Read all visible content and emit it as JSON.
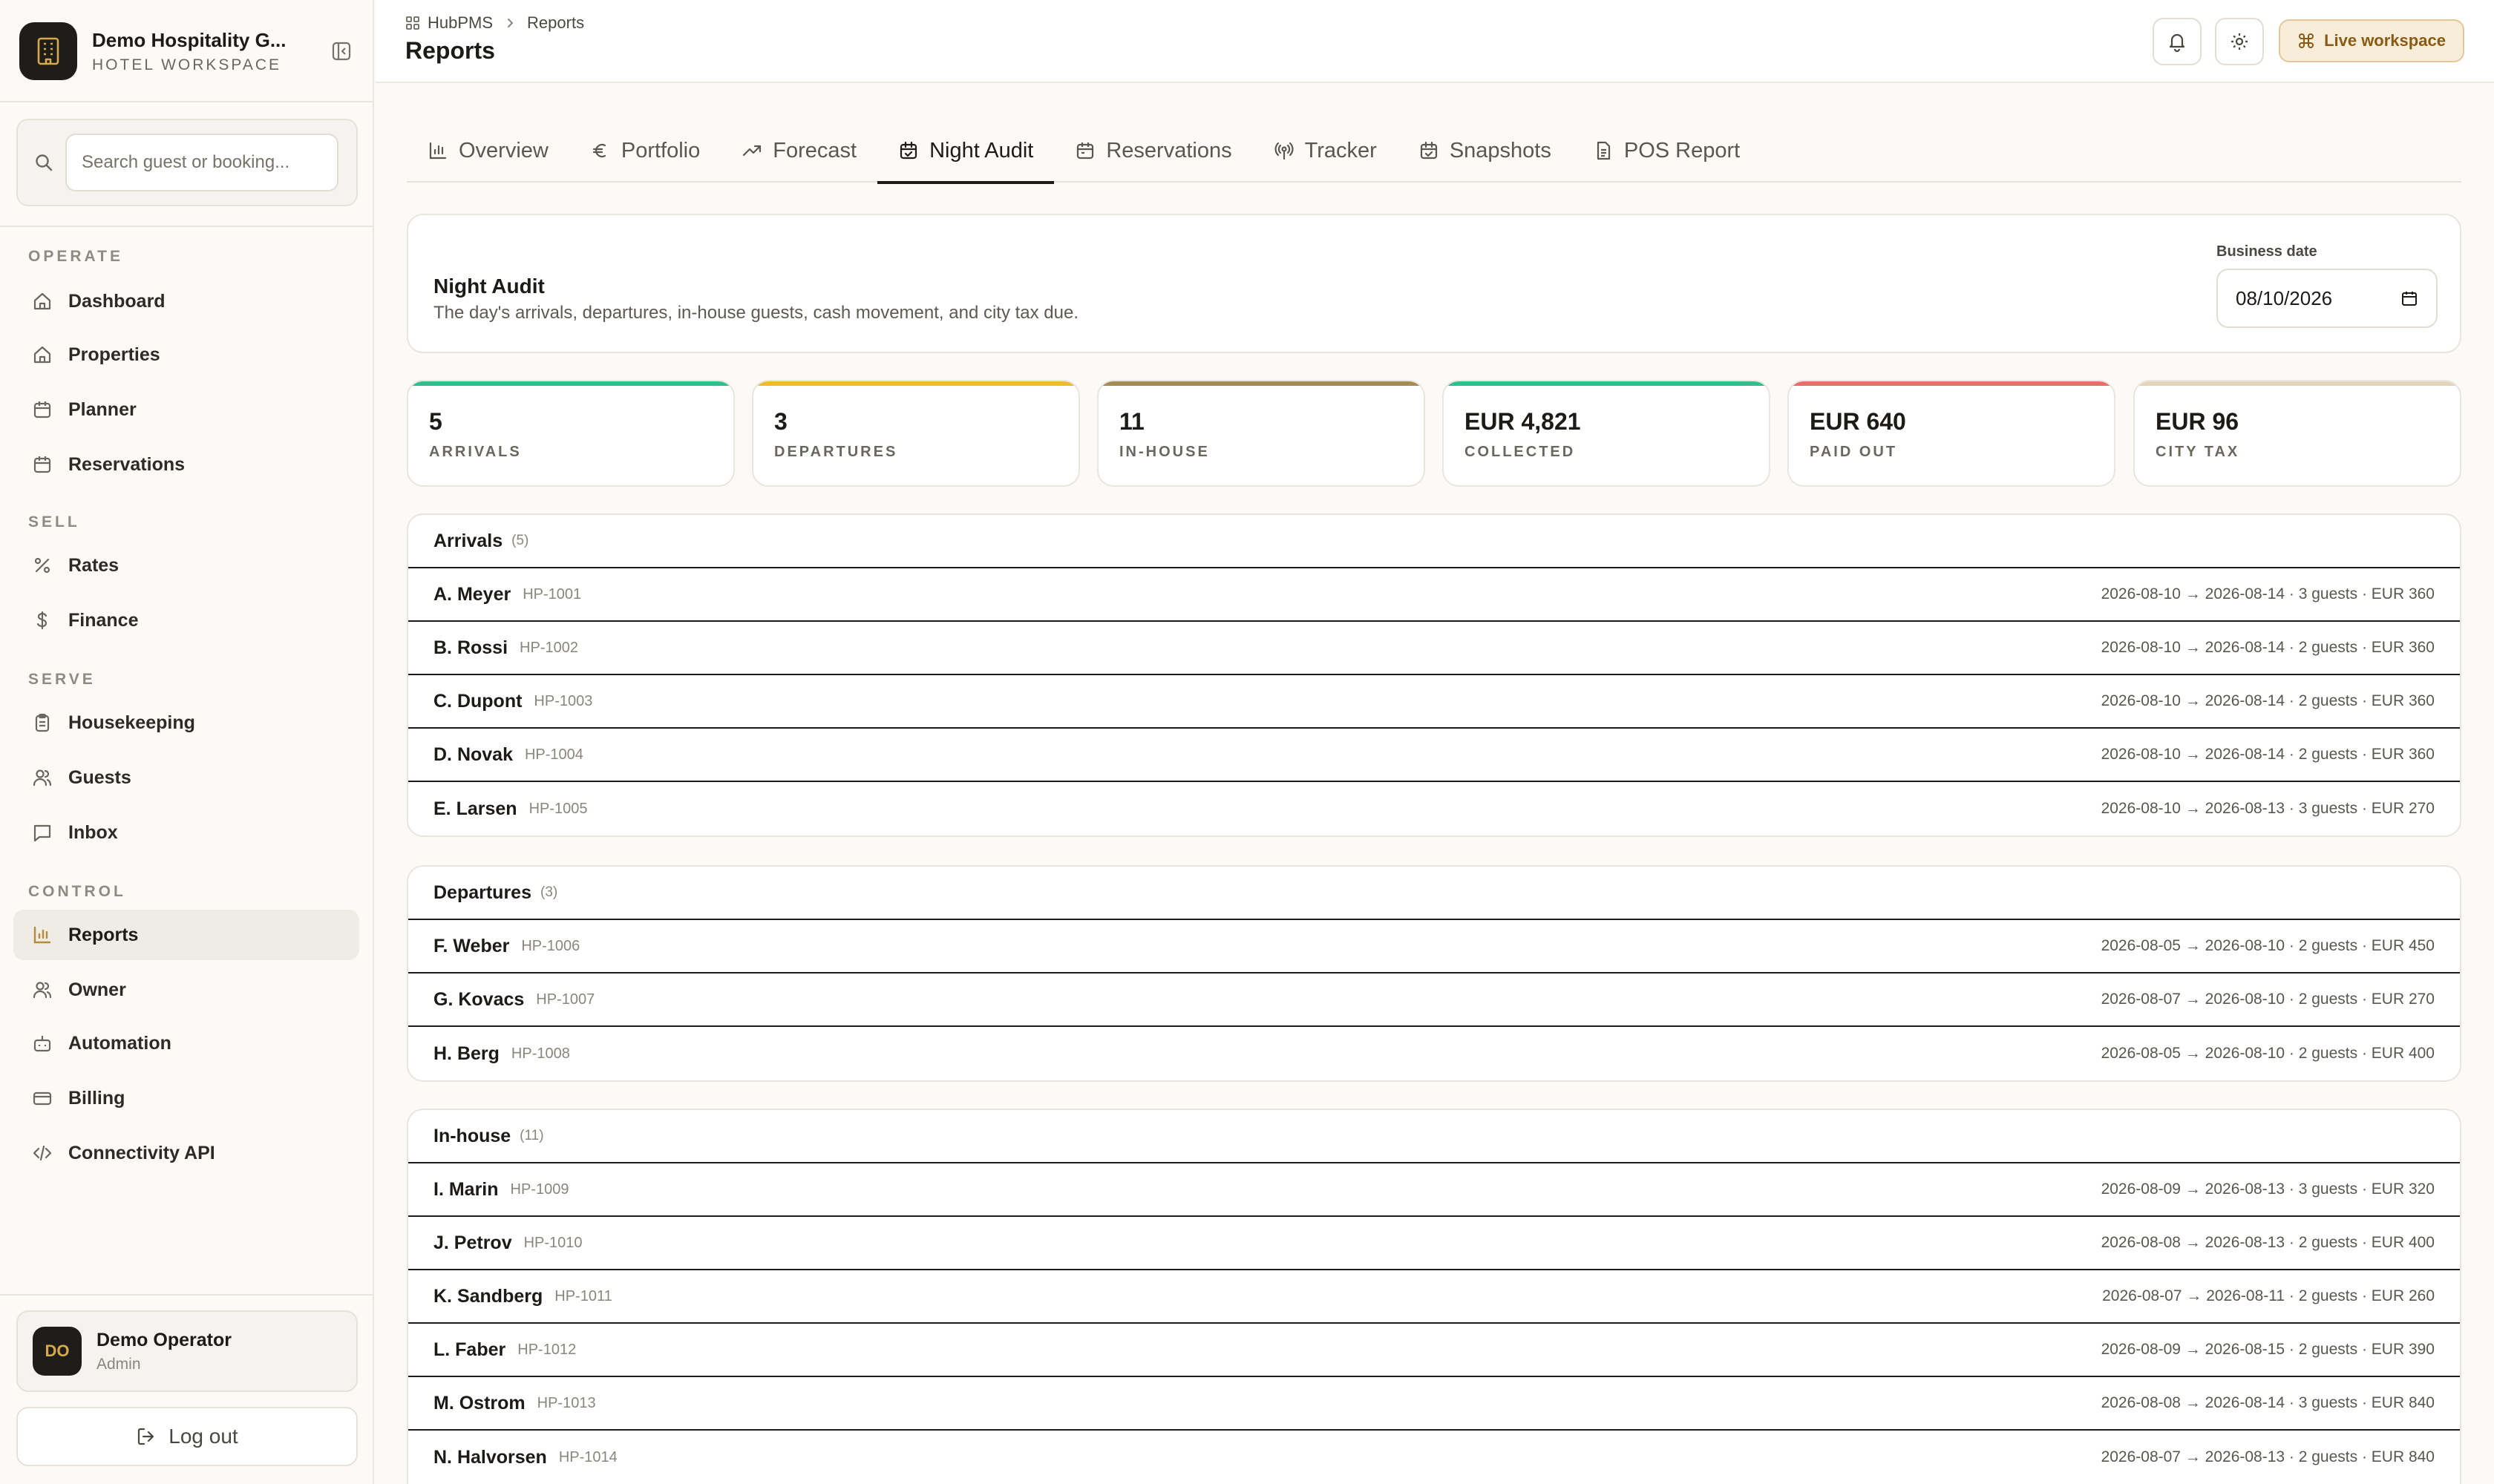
{
  "brand": {
    "name": "Demo Hospitality G...",
    "subtitle": "HOTEL WORKSPACE"
  },
  "search": {
    "placeholder": "Search guest or booking..."
  },
  "nav": {
    "sections": [
      {
        "label": "OPERATE",
        "items": [
          "Dashboard",
          "Properties",
          "Planner",
          "Reservations"
        ]
      },
      {
        "label": "SELL",
        "items": [
          "Rates",
          "Finance"
        ]
      },
      {
        "label": "SERVE",
        "items": [
          "Housekeeping",
          "Guests",
          "Inbox"
        ]
      },
      {
        "label": "CONTROL",
        "items": [
          "Reports",
          "Owner",
          "Automation",
          "Billing",
          "Connectivity API"
        ]
      }
    ],
    "active": "Reports"
  },
  "user": {
    "initials": "DO",
    "name": "Demo Operator",
    "role": "Admin",
    "logout_label": "Log out"
  },
  "header": {
    "breadcrumb": [
      "HubPMS",
      "Reports"
    ],
    "title": "Reports",
    "live_label": "Live workspace"
  },
  "tabs": [
    "Overview",
    "Portfolio",
    "Forecast",
    "Night Audit",
    "Reservations",
    "Tracker",
    "Snapshots",
    "POS Report"
  ],
  "active_tab": "Night Audit",
  "audit": {
    "title": "Night Audit",
    "description": "The day's arrivals, departures, in-house guests, cash movement, and city tax due.",
    "business_date_label": "Business date",
    "business_date": "08/10/2026"
  },
  "kpis": [
    {
      "value": "5",
      "label": "ARRIVALS",
      "color": "#2fbf8f"
    },
    {
      "value": "3",
      "label": "DEPARTURES",
      "color": "#f1b92d"
    },
    {
      "value": "11",
      "label": "IN-HOUSE",
      "color": "#a58c55"
    },
    {
      "value": "EUR 4,821",
      "label": "COLLECTED",
      "color": "#2fbf8f"
    },
    {
      "value": "EUR 640",
      "label": "PAID OUT",
      "color": "#ee6b6b"
    },
    {
      "value": "EUR 96",
      "label": "CITY TAX",
      "color": "#e4d4b8"
    }
  ],
  "lists": [
    {
      "title": "Arrivals",
      "count": "(5)",
      "rows": [
        {
          "name": "A. Meyer",
          "ref": "HP-1001",
          "meta": "2026-08-10 → 2026-08-14 · 3 guests · EUR 360"
        },
        {
          "name": "B. Rossi",
          "ref": "HP-1002",
          "meta": "2026-08-10 → 2026-08-14 · 2 guests · EUR 360"
        },
        {
          "name": "C. Dupont",
          "ref": "HP-1003",
          "meta": "2026-08-10 → 2026-08-14 · 2 guests · EUR 360"
        },
        {
          "name": "D. Novak",
          "ref": "HP-1004",
          "meta": "2026-08-10 → 2026-08-14 · 2 guests · EUR 360"
        },
        {
          "name": "E. Larsen",
          "ref": "HP-1005",
          "meta": "2026-08-10 → 2026-08-13 · 3 guests · EUR 270"
        }
      ]
    },
    {
      "title": "Departures",
      "count": "(3)",
      "rows": [
        {
          "name": "F. Weber",
          "ref": "HP-1006",
          "meta": "2026-08-05 → 2026-08-10 · 2 guests · EUR 450"
        },
        {
          "name": "G. Kovacs",
          "ref": "HP-1007",
          "meta": "2026-08-07 → 2026-08-10 · 2 guests · EUR 270"
        },
        {
          "name": "H. Berg",
          "ref": "HP-1008",
          "meta": "2026-08-05 → 2026-08-10 · 2 guests · EUR 400"
        }
      ]
    },
    {
      "title": "In-house",
      "count": "(11)",
      "rows": [
        {
          "name": "I. Marin",
          "ref": "HP-1009",
          "meta": "2026-08-09 → 2026-08-13 · 3 guests · EUR 320"
        },
        {
          "name": "J. Petrov",
          "ref": "HP-1010",
          "meta": "2026-08-08 → 2026-08-13 · 2 guests · EUR 400"
        },
        {
          "name": "K. Sandberg",
          "ref": "HP-1011",
          "meta": "2026-08-07 → 2026-08-11 · 2 guests · EUR 260"
        },
        {
          "name": "L. Faber",
          "ref": "HP-1012",
          "meta": "2026-08-09 → 2026-08-15 · 2 guests · EUR 390"
        },
        {
          "name": "M. Ostrom",
          "ref": "HP-1013",
          "meta": "2026-08-08 → 2026-08-14 · 3 guests · EUR 840"
        },
        {
          "name": "N. Halvorsen",
          "ref": "HP-1014",
          "meta": "2026-08-07 → 2026-08-13 · 2 guests · EUR 840"
        }
      ]
    }
  ]
}
